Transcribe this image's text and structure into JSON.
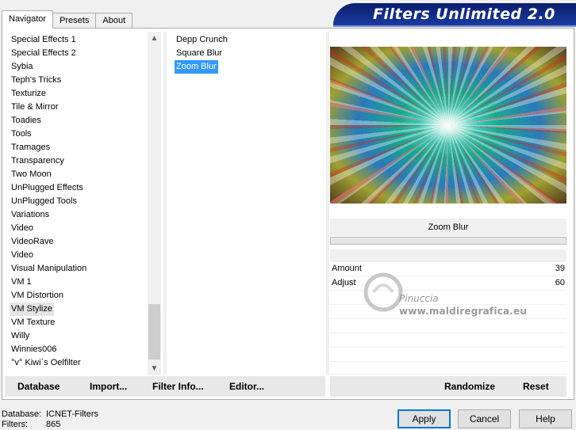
{
  "tabs": [
    {
      "label": "Navigator"
    },
    {
      "label": "Presets"
    },
    {
      "label": "About"
    }
  ],
  "banner": {
    "title": "Filters Unlimited 2.0"
  },
  "categories": [
    "Special Effects 1",
    "Special Effects 2",
    "Sybia",
    "Teph's Tricks",
    "Texturize",
    "Tile & Mirror",
    "Toadies",
    "Tools",
    "Tramages",
    "Transparency",
    "Two Moon",
    "UnPlugged Effects",
    "UnPlugged Tools",
    "Variations",
    "Video",
    "VideoRave",
    "Video",
    "Visual Manipulation",
    "VM 1",
    "VM Distortion",
    "VM Stylize",
    "VM Texture",
    "Willy",
    "Winnies006",
    "°v° Kiwi`s Oelfilter"
  ],
  "selected_category": "VM Stylize",
  "filters": [
    "Depp Crunch",
    "Square Blur",
    "Zoom Blur"
  ],
  "selected_filter": "Zoom Blur",
  "filter_name": "Zoom Blur",
  "params": [
    {
      "label": "Amount",
      "value": "39"
    },
    {
      "label": "Adjust",
      "value": "60"
    }
  ],
  "watermark": {
    "name": "Pinuccia",
    "url": "www.maldiregrafica.eu"
  },
  "left_buttons": {
    "database": "Database",
    "import": "Import...",
    "filter_info": "Filter Info...",
    "editor": "Editor..."
  },
  "right_buttons": {
    "randomize": "Randomize",
    "reset": "Reset"
  },
  "status": {
    "database_label": "Database:",
    "database_value": "ICNET-Filters",
    "filters_label": "Filters:",
    "filters_value": "865"
  },
  "dialog": {
    "apply": "Apply",
    "cancel": "Cancel",
    "help": "Help"
  }
}
